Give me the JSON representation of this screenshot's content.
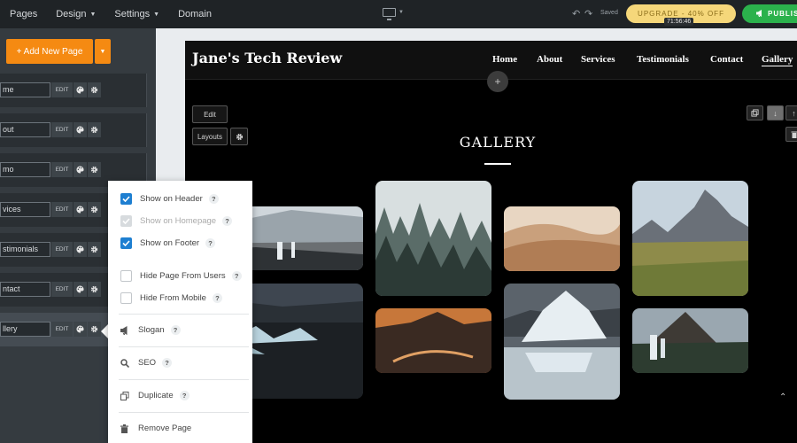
{
  "topbar": {
    "nav": [
      {
        "label": "Pages"
      },
      {
        "label": "Design"
      },
      {
        "label": "Settings"
      },
      {
        "label": "Domain"
      }
    ],
    "saved_label": "Saved",
    "upgrade_label": "UPGRADE - 40% OFF",
    "timer": "71:56:46",
    "publish_label": "PUBLISH"
  },
  "sidebar": {
    "add_page_label": "+ Add New Page",
    "edit_label": "EDIT",
    "pages": [
      {
        "name": "me"
      },
      {
        "name": "out"
      },
      {
        "name": "mo"
      },
      {
        "name": "vices"
      },
      {
        "name": "stimonials"
      },
      {
        "name": "ntact"
      },
      {
        "name": "llery"
      }
    ]
  },
  "site": {
    "title": "Jane's Tech Review",
    "nav": [
      "Home",
      "About",
      "Services",
      "Testimonials",
      "Contact",
      "Gallery"
    ],
    "active_nav": "Gallery",
    "edit_label": "Edit",
    "layouts_label": "Layouts",
    "gallery_title": "GALLERY",
    "photos": [
      {
        "subject": "snowy waterfall valley"
      },
      {
        "subject": "misty pine forest"
      },
      {
        "subject": "sand dunes"
      },
      {
        "subject": "rocky mountain peaks"
      },
      {
        "subject": "icebergs in lagoon"
      },
      {
        "subject": "sunset over mountain river"
      },
      {
        "subject": "glacier iceberg"
      },
      {
        "subject": "waterfall with mountain"
      }
    ]
  },
  "menu": {
    "items": [
      {
        "label": "Show on Header",
        "checked": true,
        "disabled": false
      },
      {
        "label": "Show on Homepage",
        "checked": true,
        "disabled": true
      },
      {
        "label": "Show on Footer",
        "checked": true,
        "disabled": false
      },
      {
        "label": "Hide Page From Users",
        "checked": false,
        "disabled": false
      },
      {
        "label": "Hide From Mobile",
        "checked": false,
        "disabled": false
      },
      {
        "label": "Slogan"
      },
      {
        "label": "SEO"
      },
      {
        "label": "Duplicate"
      },
      {
        "label": "Remove Page"
      }
    ],
    "help": "?"
  },
  "colors": {
    "accent_orange": "#f58a12",
    "publish_green": "#2bb24c",
    "upgrade_yellow": "#f5d77a",
    "checkbox_blue": "#1e7fd1"
  }
}
